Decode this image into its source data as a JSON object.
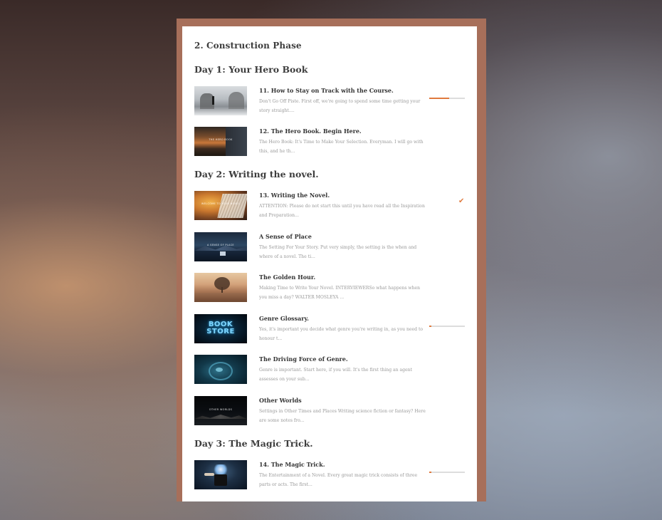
{
  "section": {
    "title": "2. Construction Phase"
  },
  "days": [
    {
      "title": "Day 1: Your Hero Book"
    },
    {
      "title": "Day 2: Writing the novel."
    },
    {
      "title": "Day 3: The Magic Trick."
    }
  ],
  "lessons": [
    {
      "title": "11. How to Stay on Track with the Course.",
      "desc": "Don't Go Off Piste. First off, we're going to spend some time getting your story straight....",
      "progress": 0.55,
      "thumb_caption": ""
    },
    {
      "title": "12. The Hero Book. Begin Here.",
      "desc": "The Hero Book: It's Time to Make Your Selection. Everyman. I will go with this, and he th...",
      "progress": null,
      "thumb_caption": "THE HERO BOOK"
    },
    {
      "title": "13. Writing the Novel.",
      "desc": "ATTENTION: Please do not start this until you have read all the Inspiration and Preparation...",
      "completed": true,
      "thumb_caption": "WELCOME TO YOUR NOVEL"
    },
    {
      "title": "A Sense of Place",
      "desc": "The Setting For Your Story. Put very simply, the setting is the when and where of a novel. The ti...",
      "progress": null,
      "thumb_caption": "A SENSE OF PLACE"
    },
    {
      "title": "The Golden Hour.",
      "desc": "Making Time to Write Your Novel. INTERVIEWERSo what happens when you miss a day? WALTER MOSLEYA ...",
      "progress": null,
      "thumb_caption": ""
    },
    {
      "title": "Genre Glossary.",
      "desc": "Yes, it's important you decide what genre you're writing in, as you need to honour t...",
      "progress": 0.05,
      "thumb_caption": "BOOK STORE"
    },
    {
      "title": "The Driving Force of Genre.",
      "desc": "Genre is important. Start here, if you will. It's the first thing an agent assesses on your sub...",
      "progress": null,
      "thumb_caption": ""
    },
    {
      "title": "Other Worlds",
      "desc": "Settings in Other Times and Places Writing science fiction or fantasy? Here are some notes fro...",
      "progress": null,
      "thumb_caption": "OTHER WORLDS"
    },
    {
      "title": "14. The Magic Trick.",
      "desc": "The Entertainment of a Novel. Every great magic trick consists of three parts or acts. The first...",
      "progress": 0.05,
      "thumb_caption": ""
    }
  ],
  "colors": {
    "accent": "#e07a3e",
    "frame": "#a76f5a",
    "track": "#dddddd"
  },
  "icons": {
    "completed": "checkmark-icon"
  }
}
